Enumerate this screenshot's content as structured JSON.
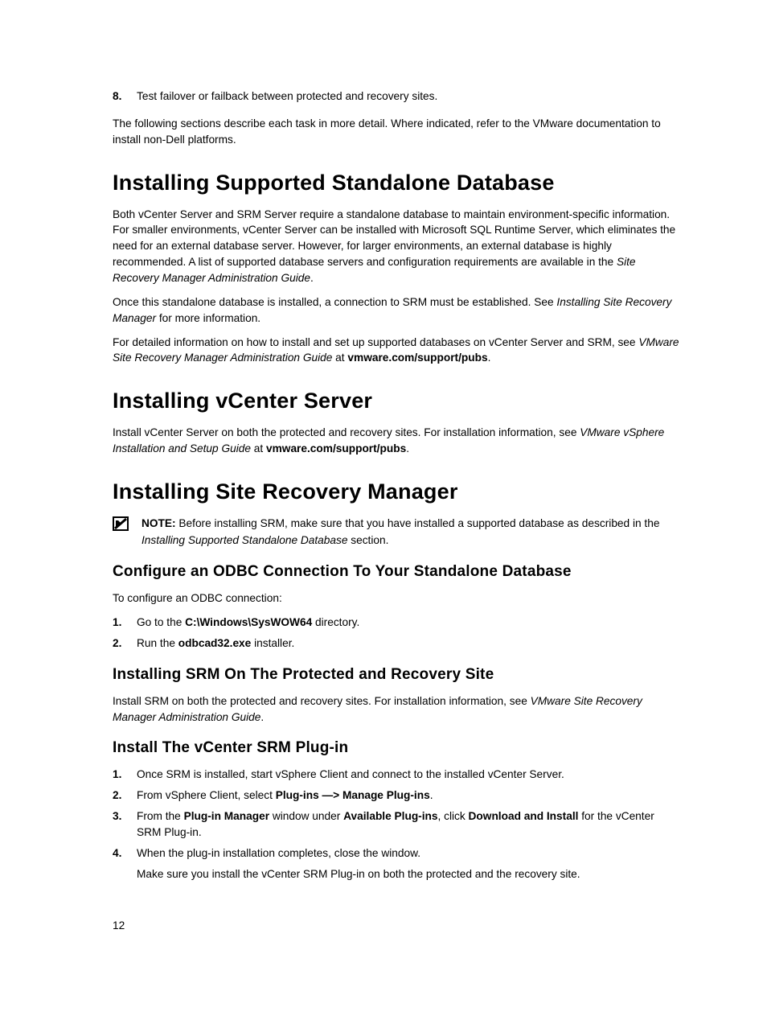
{
  "pageNumber": "12",
  "topStep": {
    "num": "8.",
    "text": "Test failover or failback between protected and recovery sites."
  },
  "introPara": "The following sections describe each task in more detail. Where indicated, refer to the VMware documentation to install non-Dell platforms.",
  "sec1": {
    "heading": "Installing Supported Standalone Database",
    "p1a": "Both vCenter Server and SRM Server require a standalone database to maintain environment-specific information. For smaller environments, vCenter Server can be installed with Microsoft SQL Runtime Server, which eliminates the need for an external database server. However, for larger environments, an external database is highly recommended. A list of supported database servers and configuration requirements are available in the ",
    "p1i": "Site Recovery Manager Administration Guide",
    "p1b": ".",
    "p2a": "Once this standalone database is installed, a connection to SRM must be established. See ",
    "p2i": "Installing Site Recovery Manager",
    "p2b": " for more information.",
    "p3a": "For detailed information on how to install and set up supported databases on vCenter Server and SRM, see ",
    "p3i": "VMware Site Recovery Manager Administration Guide",
    "p3b": " at ",
    "p3bold": "vmware.com/support/pubs",
    "p3c": "."
  },
  "sec2": {
    "heading": "Installing vCenter Server",
    "p1a": "Install vCenter Server on both the protected and recovery sites. For installation information, see ",
    "p1i": "VMware vSphere Installation and Setup Guide",
    "p1b": " at ",
    "p1bold": "vmware.com/support/pubs",
    "p1c": "."
  },
  "sec3": {
    "heading": "Installing Site Recovery Manager",
    "noteLabel": "NOTE:",
    "noteA": " Before installing SRM, make sure that you have installed a supported database as described in the ",
    "noteI": "Installing Supported Standalone Database",
    "noteB": " section.",
    "sub1": {
      "heading": "Configure an ODBC Connection To Your Standalone Database",
      "intro": "To configure an ODBC connection:",
      "s1num": "1.",
      "s1a": "Go to the ",
      "s1bold": "C:\\Windows\\SysWOW64",
      "s1b": " directory.",
      "s2num": "2.",
      "s2a": "Run the ",
      "s2bold": "odbcad32.exe",
      "s2b": " installer."
    },
    "sub2": {
      "heading": "Installing SRM On The Protected and Recovery Site",
      "p1a": "Install SRM on both the protected and recovery sites. For installation information, see ",
      "p1i": "VMware Site Recovery Manager Administration Guide",
      "p1b": "."
    },
    "sub3": {
      "heading": "Install The vCenter SRM Plug-in",
      "s1num": "1.",
      "s1": "Once SRM is installed, start vSphere Client and connect to the installed vCenter Server.",
      "s2num": "2.",
      "s2a": "From vSphere Client, select ",
      "s2bold": "Plug-ins —> Manage Plug-ins",
      "s2b": ".",
      "s3num": "3.",
      "s3a": "From the ",
      "s3bold1": "Plug-in Manager",
      "s3b": " window under ",
      "s3bold2": "Available Plug-ins",
      "s3c": ", click ",
      "s3bold3": "Download and Install",
      "s3d": " for the vCenter SRM Plug-in.",
      "s4num": "4.",
      "s4a": "When the plug-in installation completes, close the window.",
      "s4b": "Make sure you install the vCenter SRM Plug-in on both the protected and the recovery site."
    }
  }
}
